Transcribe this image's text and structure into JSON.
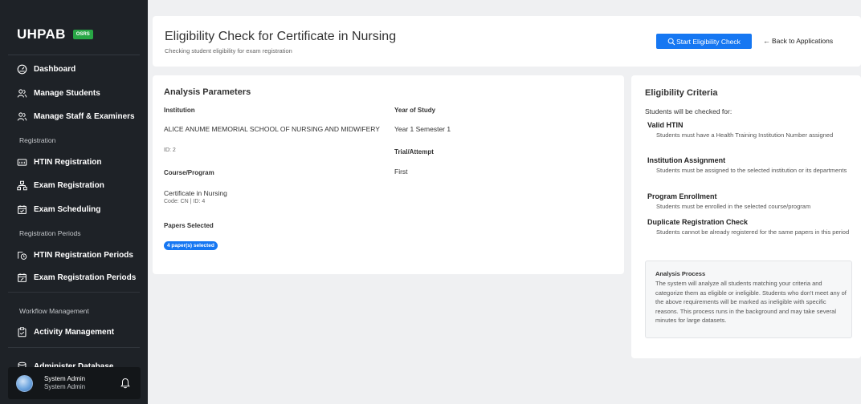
{
  "sidebar": {
    "brand": "UHPAB",
    "brand_badge": "OSRS",
    "items": [
      {
        "label": "Dashboard",
        "icon": "dashboard-icon"
      },
      {
        "label": "Manage Students",
        "icon": "users-icon"
      },
      {
        "label": "Manage Staff & Examiners",
        "icon": "users-icon"
      },
      {
        "label": "HTIN Registration",
        "icon": "id-card-icon"
      },
      {
        "label": "Exam Registration",
        "icon": "sitemap-icon"
      },
      {
        "label": "Exam Scheduling",
        "icon": "calendar-check-icon"
      },
      {
        "label": "HTIN Registration Periods",
        "icon": "clock-icon"
      },
      {
        "label": "Exam Registration Periods",
        "icon": "calendar-edit-icon"
      },
      {
        "label": "Activity Management",
        "icon": "clipboard-icon"
      },
      {
        "label": "Administer Database",
        "icon": "database-icon"
      }
    ],
    "sections": {
      "registration": "Registration",
      "registration_periods": "Registration Periods",
      "workflow": "Workflow Management"
    },
    "user": {
      "name": "System Admin",
      "role": "System Admin"
    }
  },
  "header": {
    "title": "Eligibility Check for Certificate in Nursing",
    "subtitle": "Checking student eligibility for exam registration",
    "start_button": "Start Eligibility Check",
    "back_link": "Back to Applications"
  },
  "analysis": {
    "title": "Analysis Parameters",
    "institution_label": "Institution",
    "institution_value": "ALICE ANUME MEMORIAL SCHOOL OF NURSING AND MIDWIFERY",
    "institution_id": "ID: 2",
    "course_label": "Course/Program",
    "course_value": "Certificate in Nursing",
    "course_code": "Code: CN | ID: 4",
    "papers_label": "Papers Selected",
    "papers_badge": "4 paper(s) selected",
    "year_label": "Year of Study",
    "year_value": "Year 1 Semester 1",
    "trial_label": "Trial/Attempt",
    "trial_value": "First"
  },
  "criteria": {
    "title": "Eligibility Criteria",
    "intro": "Students will be checked for:",
    "items": [
      {
        "title": "Valid HTIN",
        "desc": "Students must have a Health Training Institution Number assigned"
      },
      {
        "title": "Institution Assignment",
        "desc": "Students must be assigned to the selected institution or its departments"
      },
      {
        "title": "Program Enrollment",
        "desc": "Students must be enrolled in the selected course/program"
      },
      {
        "title": "Duplicate Registration Check",
        "desc": "Students cannot be already registered for the same papers in this period"
      }
    ],
    "process_title": "Analysis Process",
    "process_text": "The system will analyze all students matching your criteria and categorize them as eligible or ineligible. Students who don't meet any of the above requirements will be marked as ineligible with specific reasons. This process runs in the background and may take several minutes for large datasets."
  }
}
